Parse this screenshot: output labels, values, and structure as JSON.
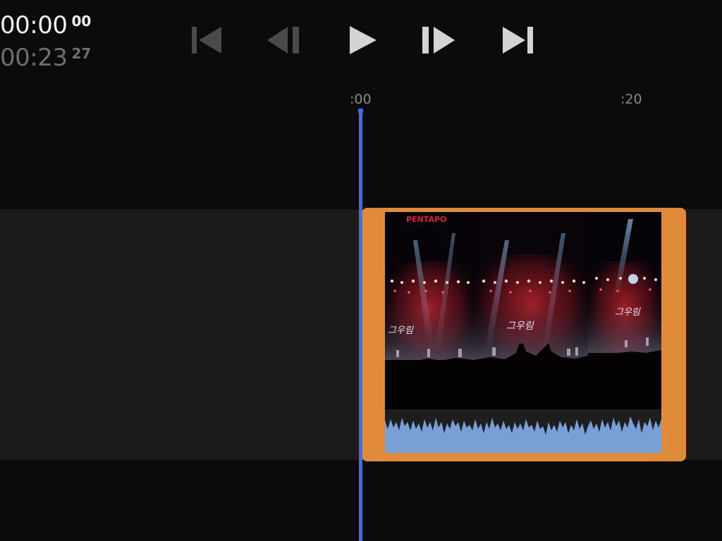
{
  "timecode": {
    "current": {
      "main": "00:00",
      "frames": "00"
    },
    "total": {
      "main": "00:23",
      "frames": "27"
    }
  },
  "transport": {
    "buttons": [
      {
        "icon": "skip-to-start-icon",
        "enabled": false
      },
      {
        "icon": "step-back-frame-icon",
        "enabled": false
      },
      {
        "icon": "play-icon",
        "enabled": true
      },
      {
        "icon": "step-forward-frame-icon",
        "enabled": true
      },
      {
        "icon": "skip-to-end-icon",
        "enabled": true
      }
    ]
  },
  "ruler": {
    "labels": [
      ":00",
      ":20"
    ]
  },
  "clip": {
    "frame_text": "PENTAPO",
    "selection_color": "#e08b3a",
    "audio_color": "#78a0d6"
  },
  "colors": {
    "background": "#0b0b0b",
    "track": "#1b1b1b",
    "playhead": "#3f6fe0"
  }
}
